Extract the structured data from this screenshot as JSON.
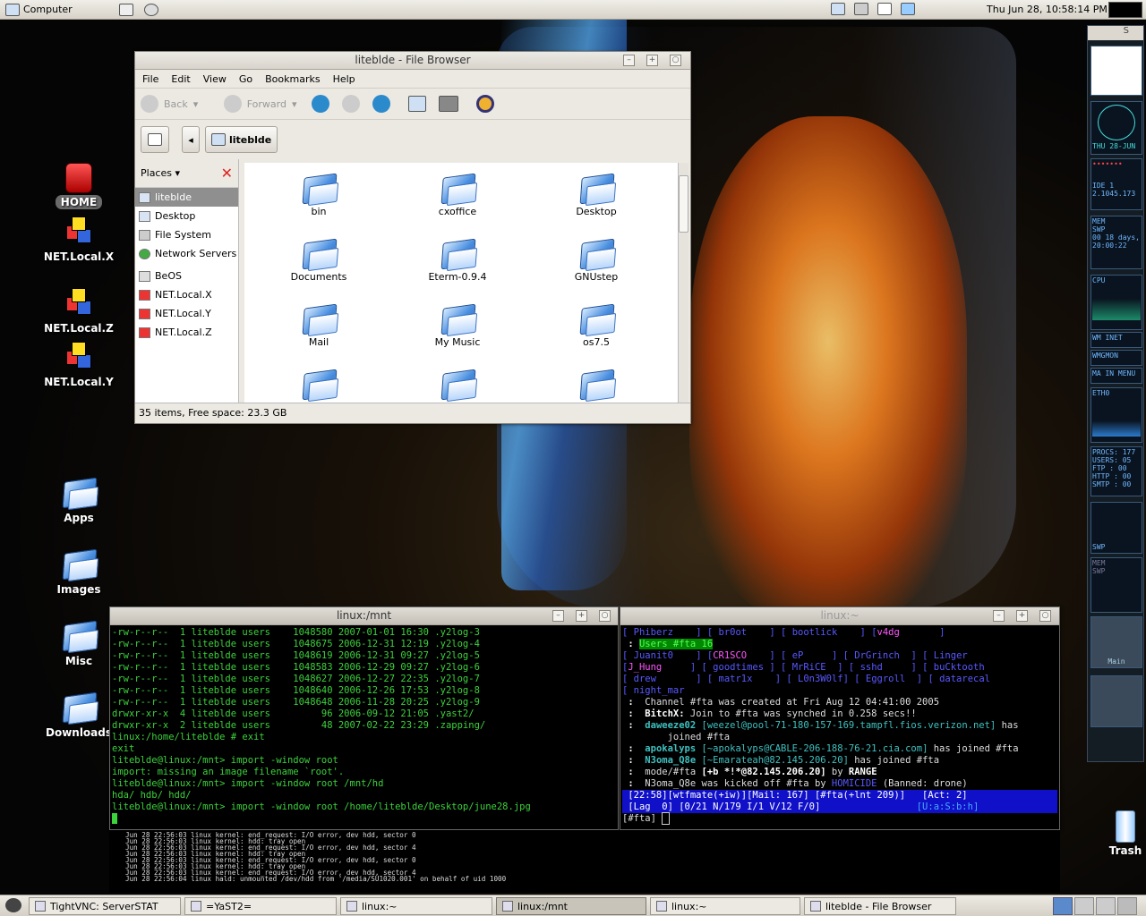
{
  "top_panel": {
    "computer_label": "Computer",
    "clock": "Thu Jun 28, 10:58:14 PM"
  },
  "desktop_icons": {
    "home": "HOME",
    "net_x": "NET.Local.X",
    "net_z": "NET.Local.Z",
    "net_y": "NET.Local.Y",
    "apps": "Apps",
    "images": "Images",
    "misc": "Misc",
    "downloads": "Downloads",
    "trash": "Trash"
  },
  "file_browser": {
    "title": "liteblde - File Browser",
    "menu": [
      "File",
      "Edit",
      "View",
      "Go",
      "Bookmarks",
      "Help"
    ],
    "toolbar": {
      "back": "Back",
      "forward": "Forward"
    },
    "location": "liteblde",
    "places_label": "Places",
    "places": [
      "liteblde",
      "Desktop",
      "File System",
      "Network Servers",
      "BeOS",
      "NET.Local.X",
      "NET.Local.Y",
      "NET.Local.Z"
    ],
    "items": [
      "bin",
      "cxoffice",
      "Desktop",
      "Documents",
      "Eterm-0.9.4",
      "GNUstep",
      "Mail",
      "My Music",
      "os7.5"
    ],
    "status": "35 items, Free space: 23.3 GB"
  },
  "term_mnt": {
    "title": "linux:/mnt",
    "lines": [
      "-rw-r--r--  1 liteblde users    1048580 2007-01-01 16:30 .y2log-3",
      "-rw-r--r--  1 liteblde users    1048675 2006-12-31 12:19 .y2log-4",
      "-rw-r--r--  1 liteblde users    1048619 2006-12-31 09:27 .y2log-5",
      "-rw-r--r--  1 liteblde users    1048583 2006-12-29 09:27 .y2log-6",
      "-rw-r--r--  1 liteblde users    1048627 2006-12-27 22:35 .y2log-7",
      "-rw-r--r--  1 liteblde users    1048640 2006-12-26 17:53 .y2log-8",
      "-rw-r--r--  1 liteblde users    1048648 2006-11-28 20:25 .y2log-9",
      "drwxr-xr-x  4 liteblde users         96 2006-09-12 21:05 .yast2/",
      "drwxr-xr-x  2 liteblde users         48 2007-02-22 23:29 .zapping/",
      "linux:/home/liteblde # exit",
      "exit",
      "liteblde@linux:/mnt> import -window root",
      "import: missing an image filename `root'.",
      "liteblde@linux:/mnt> import -window root /mnt/hd",
      "hda/ hdb/ hdd/",
      "liteblde@linux:/mnt> import -window root /home/liteblde/Desktop/june28.jpg"
    ]
  },
  "term_irc": {
    "title": "linux:~",
    "nicks_row1": [
      "Phiberz",
      "br0ot",
      "bootlick",
      "v4dg"
    ],
    "users_label": "Users #fta 16",
    "nicks_row2": [
      "Juanit0",
      "CR1SCO",
      "eP",
      "DrGrinch",
      "Linger"
    ],
    "nicks_row3": [
      "J_Hung",
      "goodtimes",
      "MrRiCE",
      "sshd",
      "buCktooth"
    ],
    "nicks_row4": [
      "drew",
      "matr1x",
      "L0n3W0lf",
      "Eggroll",
      "datarecal"
    ],
    "nicks_row5": [
      "night_mar"
    ],
    "msg1": "Channel #fta was created at Fri Aug 12 04:41:00 2005",
    "msg2a": "BitchX:",
    "msg2b": " Join to #fta was synched in 0.258 secs!!",
    "msg3a": "daweeze02",
    "msg3b": "[weezel@pool-71-180-157-169.tampfl.fios.verizon.net]",
    "msg3c": " has",
    "msg3d": "joined #fta",
    "msg4a": "apokalyps",
    "msg4b": "[~apokalyps@CABLE-206-188-76-21.cia.com]",
    "msg4c": " has joined #fta",
    "msg5a": "N3oma_Q8e",
    "msg5b": "[~Emarateah@82.145.206.20]",
    "msg5c": " has joined #fta",
    "msg6a": "mode/#fta",
    "msg6b": "[+b *!*@82.145.206.20]",
    "msg6c": " by ",
    "msg6d": "RANGE",
    "msg7a": "N3oma_Q8e was kicked off #fta by ",
    "msg7b": "HOMICIDE",
    "msg7c": " (Banned: drone)",
    "status1": "[22:58][wtfmate(+iw)][Mail: 167] [#fta(+lnt 209)]   [Act: 2]",
    "status2": "[Lag  0] [0/21 N/179 I/1 V/12 F/0]",
    "status2r": "[U:a:S:b:h]",
    "prompt": "[#fta] "
  },
  "syslog": {
    "lines": [
      "Jun 28 22:56:03 linux kernel: end_request: I/O error, dev hdd, sector 0",
      "Jun 28 22:56:03 linux kernel: hdd: tray open",
      "Jun 28 22:56:03 linux kernel: end_request: I/O error, dev hdd, sector 4",
      "Jun 28 22:56:03 linux kernel: hdd: tray open",
      "Jun 28 22:56:03 linux kernel: end_request: I/O error, dev hdd, sector 0",
      "Jun 28 22:56:03 linux kernel: hdd: tray open",
      "Jun 28 22:56:03 linux kernel: end_request: I/O error, dev hdd, sector 4",
      "Jun 28 22:56:04 linux hald: unmounted /dev/hdd from '/media/SU1020.001' on behalf of uid 1000"
    ]
  },
  "gkrellm": {
    "date": "THU 28-JUN",
    "ide": "IDE 1",
    "disk": "2.1045.173",
    "mem": "MEM",
    "swp": "SWP",
    "uptime1": "00 18 days,",
    "uptime2": "20:00:22",
    "cpu": "CPU",
    "inet": "WM INET",
    "wmgmon": "WMGMON",
    "main_menu": "MA IN  MENU",
    "eth": "ETH0",
    "procs": "PROCS: 177",
    "users": "USERS: 05",
    "ftp": "FTP  : 00",
    "http": "HTTP : 00",
    "smtp": "SMTP : 00",
    "main": "Main"
  },
  "taskbar": [
    "TightVNC: ServerSTAT",
    "=YaST2=",
    "linux:~",
    "linux:/mnt",
    "linux:~",
    "liteblde - File Browser"
  ]
}
